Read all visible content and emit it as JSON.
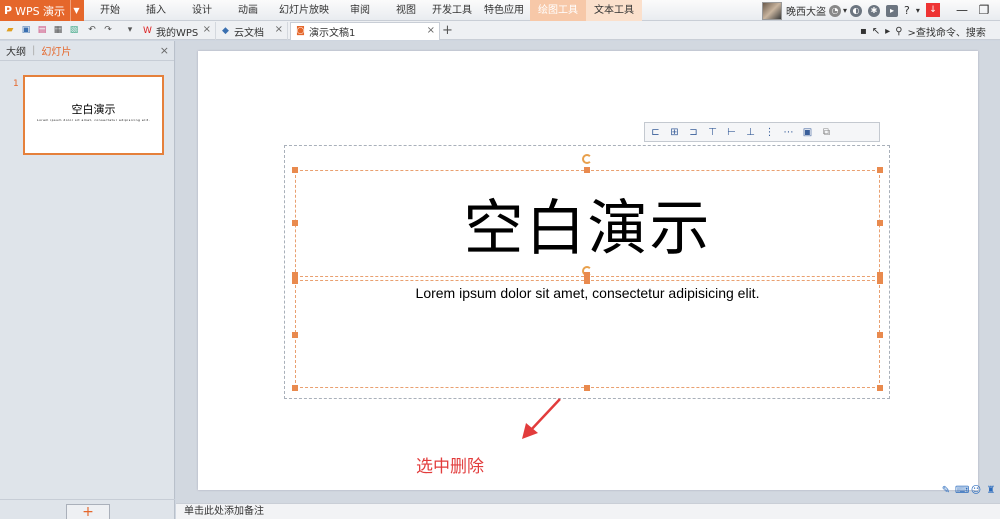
{
  "app": {
    "name": "WPS 演示",
    "logo": "P"
  },
  "menu": {
    "items": [
      "开始",
      "插入",
      "设计",
      "动画",
      "幻灯片放映",
      "审阅",
      "视图",
      "开发工具",
      "特色应用",
      "绘图工具",
      "文本工具"
    ]
  },
  "user": {
    "name": "晚西大盗"
  },
  "tabs": [
    {
      "label": "我的WPS",
      "icon": "wps-icon"
    },
    {
      "label": "云文档",
      "icon": "cloud-icon"
    },
    {
      "label": "演示文稿1",
      "icon": "presentation-icon"
    }
  ],
  "toolbar": {
    "search_label": "查找命令、搜索"
  },
  "left_panel": {
    "tab_outline": "大纲",
    "tab_slides": "幻灯片",
    "slide_number": "1",
    "add_label": "+"
  },
  "slide": {
    "title": "空白演示",
    "subtitle": "Lorem ipsum dolor sit amet, consectetur adipisicing elit."
  },
  "notes": {
    "placeholder": "单击此处添加备注"
  },
  "annotation": {
    "text": "选中删除",
    "color": "#e23c3c"
  },
  "colors": {
    "accent": "#e5672b",
    "selection": "#e98a4e"
  }
}
